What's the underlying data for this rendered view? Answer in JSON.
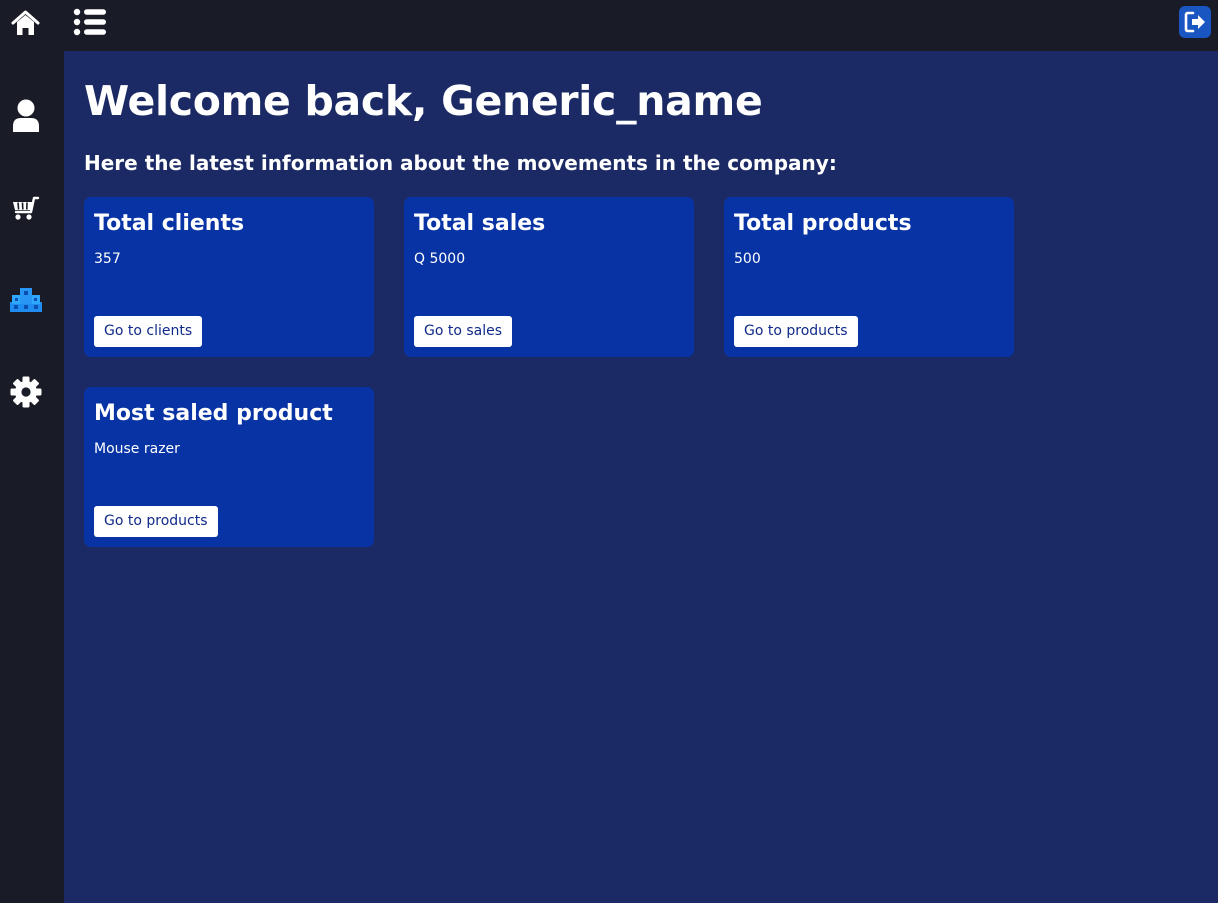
{
  "nav": {
    "icons": [
      "home-icon",
      "menu-list-icon",
      "logout-icon",
      "user-icon",
      "cart-icon",
      "boxes-icon",
      "gear-icon"
    ]
  },
  "colors": {
    "background": "#1b2a65",
    "sidebar": "#191c26",
    "card": "#0733a4",
    "accent": "#1a56c2"
  },
  "main": {
    "welcome": "Welcome back, Generic_name",
    "subtitle": "Here the latest information about the movements in the company:",
    "cards": [
      {
        "title": "Total clients",
        "value": "357",
        "button": "Go to clients"
      },
      {
        "title": "Total sales",
        "value": "Q 5000",
        "button": "Go to sales"
      },
      {
        "title": "Total products",
        "value": "500",
        "button": "Go to products"
      },
      {
        "title": "Most saled product",
        "value": "Mouse razer",
        "button": "Go to products"
      }
    ]
  }
}
